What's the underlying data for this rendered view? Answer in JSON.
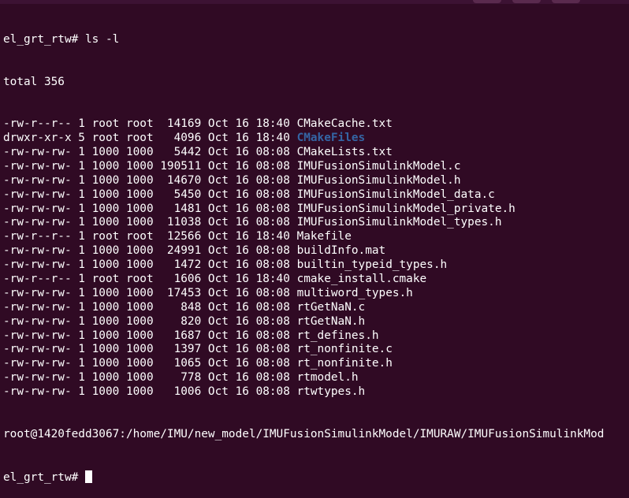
{
  "window": {
    "theme": {
      "background": "#300a24",
      "foreground": "#ffffff",
      "directory_color": "#3465a4"
    }
  },
  "terminal": {
    "prompt_top": "el_grt_rtw# ls -l",
    "total": "total 356",
    "entries": [
      {
        "perms": "-rw-r--r--",
        "links": "1",
        "owner": "root",
        "group": "root",
        "size": "14169",
        "month": "Oct",
        "day": "16",
        "time": "18:40",
        "name": "CMakeCache.txt",
        "is_dir": false
      },
      {
        "perms": "drwxr-xr-x",
        "links": "5",
        "owner": "root",
        "group": "root",
        "size": "4096",
        "month": "Oct",
        "day": "16",
        "time": "18:40",
        "name": "CMakeFiles",
        "is_dir": true
      },
      {
        "perms": "-rw-rw-rw-",
        "links": "1",
        "owner": "1000",
        "group": "1000",
        "size": "5442",
        "month": "Oct",
        "day": "16",
        "time": "08:08",
        "name": "CMakeLists.txt",
        "is_dir": false
      },
      {
        "perms": "-rw-rw-rw-",
        "links": "1",
        "owner": "1000",
        "group": "1000",
        "size": "190511",
        "month": "Oct",
        "day": "16",
        "time": "08:08",
        "name": "IMUFusionSimulinkModel.c",
        "is_dir": false
      },
      {
        "perms": "-rw-rw-rw-",
        "links": "1",
        "owner": "1000",
        "group": "1000",
        "size": "14670",
        "month": "Oct",
        "day": "16",
        "time": "08:08",
        "name": "IMUFusionSimulinkModel.h",
        "is_dir": false
      },
      {
        "perms": "-rw-rw-rw-",
        "links": "1",
        "owner": "1000",
        "group": "1000",
        "size": "5450",
        "month": "Oct",
        "day": "16",
        "time": "08:08",
        "name": "IMUFusionSimulinkModel_data.c",
        "is_dir": false
      },
      {
        "perms": "-rw-rw-rw-",
        "links": "1",
        "owner": "1000",
        "group": "1000",
        "size": "1481",
        "month": "Oct",
        "day": "16",
        "time": "08:08",
        "name": "IMUFusionSimulinkModel_private.h",
        "is_dir": false
      },
      {
        "perms": "-rw-rw-rw-",
        "links": "1",
        "owner": "1000",
        "group": "1000",
        "size": "11038",
        "month": "Oct",
        "day": "16",
        "time": "08:08",
        "name": "IMUFusionSimulinkModel_types.h",
        "is_dir": false
      },
      {
        "perms": "-rw-r--r--",
        "links": "1",
        "owner": "root",
        "group": "root",
        "size": "12566",
        "month": "Oct",
        "day": "16",
        "time": "18:40",
        "name": "Makefile",
        "is_dir": false
      },
      {
        "perms": "-rw-rw-rw-",
        "links": "1",
        "owner": "1000",
        "group": "1000",
        "size": "24991",
        "month": "Oct",
        "day": "16",
        "time": "08:08",
        "name": "buildInfo.mat",
        "is_dir": false
      },
      {
        "perms": "-rw-rw-rw-",
        "links": "1",
        "owner": "1000",
        "group": "1000",
        "size": "1472",
        "month": "Oct",
        "day": "16",
        "time": "08:08",
        "name": "builtin_typeid_types.h",
        "is_dir": false
      },
      {
        "perms": "-rw-r--r--",
        "links": "1",
        "owner": "root",
        "group": "root",
        "size": "1606",
        "month": "Oct",
        "day": "16",
        "time": "18:40",
        "name": "cmake_install.cmake",
        "is_dir": false
      },
      {
        "perms": "-rw-rw-rw-",
        "links": "1",
        "owner": "1000",
        "group": "1000",
        "size": "17453",
        "month": "Oct",
        "day": "16",
        "time": "08:08",
        "name": "multiword_types.h",
        "is_dir": false
      },
      {
        "perms": "-rw-rw-rw-",
        "links": "1",
        "owner": "1000",
        "group": "1000",
        "size": "848",
        "month": "Oct",
        "day": "16",
        "time": "08:08",
        "name": "rtGetNaN.c",
        "is_dir": false
      },
      {
        "perms": "-rw-rw-rw-",
        "links": "1",
        "owner": "1000",
        "group": "1000",
        "size": "820",
        "month": "Oct",
        "day": "16",
        "time": "08:08",
        "name": "rtGetNaN.h",
        "is_dir": false
      },
      {
        "perms": "-rw-rw-rw-",
        "links": "1",
        "owner": "1000",
        "group": "1000",
        "size": "1687",
        "month": "Oct",
        "day": "16",
        "time": "08:08",
        "name": "rt_defines.h",
        "is_dir": false
      },
      {
        "perms": "-rw-rw-rw-",
        "links": "1",
        "owner": "1000",
        "group": "1000",
        "size": "1397",
        "month": "Oct",
        "day": "16",
        "time": "08:08",
        "name": "rt_nonfinite.c",
        "is_dir": false
      },
      {
        "perms": "-rw-rw-rw-",
        "links": "1",
        "owner": "1000",
        "group": "1000",
        "size": "1065",
        "month": "Oct",
        "day": "16",
        "time": "08:08",
        "name": "rt_nonfinite.h",
        "is_dir": false
      },
      {
        "perms": "-rw-rw-rw-",
        "links": "1",
        "owner": "1000",
        "group": "1000",
        "size": "778",
        "month": "Oct",
        "day": "16",
        "time": "08:08",
        "name": "rtmodel.h",
        "is_dir": false
      },
      {
        "perms": "-rw-rw-rw-",
        "links": "1",
        "owner": "1000",
        "group": "1000",
        "size": "1006",
        "month": "Oct",
        "day": "16",
        "time": "08:08",
        "name": "rtwtypes.h",
        "is_dir": false
      }
    ],
    "prompt_path": "root@1420fedd3067:/home/IMU/new_model/IMUFusionSimulinkModel/IMURAW/IMUFusionSimulinkMod",
    "prompt_last": "el_grt_rtw# "
  }
}
